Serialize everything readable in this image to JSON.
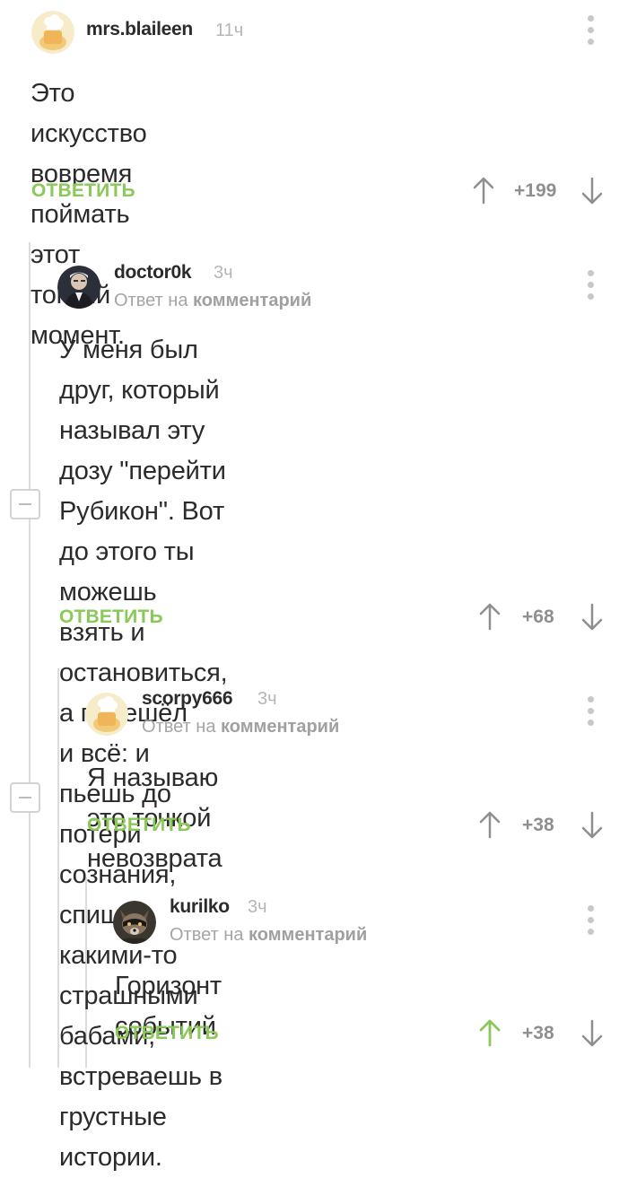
{
  "comments": [
    {
      "username": "mrs.blaileen",
      "time": "11ч",
      "avatar": "chef-hat-avatar",
      "reply_to_prefix": "",
      "reply_to_link": "",
      "lines": [
        "Это искусство вовремя поймать этот",
        "тонкий момент."
      ],
      "reply_label": "ОТВЕТИТЬ",
      "score": "+199",
      "upvote_active": false
    },
    {
      "username": "doctor0k",
      "time": "3ч",
      "avatar": "person-portrait-avatar",
      "reply_to_prefix": "Ответ на ",
      "reply_to_link": "комментарий",
      "lines": [
        "У меня был друг, который называл эту",
        "дозу \"перейти Рубикон\". Вот до этого ты",
        "можешь взять и остановиться, а перешёл",
        "и всё: и пьешь до потери сознания,",
        "спишь с какими-то страшными бабами,",
        "встреваешь в грустные истории."
      ],
      "reply_label": "ОТВЕТИТЬ",
      "score": "+68",
      "upvote_active": false
    },
    {
      "username": "scorpy666",
      "time": "3ч",
      "avatar": "chef-hat-avatar",
      "reply_to_prefix": "Ответ на ",
      "reply_to_link": "комментарий",
      "lines": [
        "Я называю это точкой невозврата"
      ],
      "reply_label": "ОТВЕТИТЬ",
      "score": "+38",
      "upvote_active": false
    },
    {
      "username": "kurilko",
      "time": "3ч",
      "avatar": "raccoon-avatar",
      "reply_to_prefix": "Ответ на ",
      "reply_to_link": "комментарий",
      "lines": [
        "Горизонт событий"
      ],
      "reply_label": "ОТВЕТИТЬ",
      "score": "+38",
      "upvote_active": true
    }
  ],
  "colors": {
    "reply_green": "#8ac858",
    "upvote_active": "#8ac858",
    "arrow_inactive": "#8f8f8f",
    "thread_line": "#dcdcdc"
  }
}
